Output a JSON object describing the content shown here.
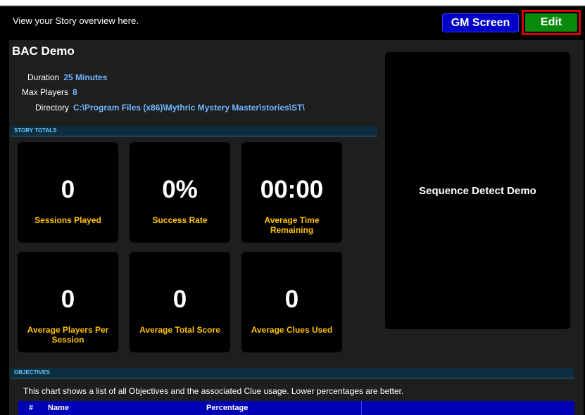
{
  "header": {
    "text": "View your Story overview here.",
    "gm_screen_label": "GM Screen",
    "edit_label": "Edit"
  },
  "story": {
    "title": "BAC Demo",
    "duration_label": "Duration",
    "duration_value": "25 Minutes",
    "max_players_label": "Max Players",
    "max_players_value": "8",
    "directory_label": "Directory",
    "directory_value": "C:\\Program Files (x86)\\Mythric Mystery Master\\stories\\ST\\"
  },
  "totals": {
    "section_label": "STORY TOTALS",
    "cards": [
      {
        "value": "0",
        "label": "Sessions Played"
      },
      {
        "value": "0%",
        "label": "Success Rate"
      },
      {
        "value": "00:00",
        "label": "Average Time Remaining"
      },
      {
        "value": "0",
        "label": "Average Players Per Session"
      },
      {
        "value": "0",
        "label": "Average Total Score"
      },
      {
        "value": "0",
        "label": "Average Clues Used"
      }
    ]
  },
  "side": {
    "title": "Sequence Detect Demo"
  },
  "objectives": {
    "section_label": "OBJECTIVES",
    "description": "This chart shows a list of all Objectives and the associated Clue usage. Lower percentages are better.",
    "columns": [
      "#",
      "Name",
      "Percentage"
    ]
  },
  "colors": {
    "gm_button": "#0000c8",
    "edit_button": "#0a8a0a",
    "edit_highlight": "#e00000",
    "stat_label": "#ffc200",
    "info_value": "#6fb6ff",
    "table_header": "#0000b4"
  }
}
